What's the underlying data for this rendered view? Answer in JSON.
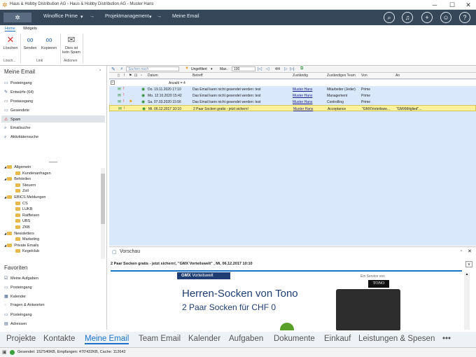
{
  "window": {
    "title": "Haus & Hobby Distribution AG - Haus & Hobby Distribution AG - Muster Hans",
    "min": "─",
    "max": "☐",
    "close": "✕"
  },
  "nav": {
    "app": "Winoffice Prime",
    "module": "Projektmanagement",
    "page": "Meine Email"
  },
  "ribbon": {
    "tabs": [
      "Home",
      "Widgets"
    ],
    "buttons": [
      {
        "label": "Löschen",
        "icon": "✕"
      },
      {
        "label": "Senden",
        "icon": "∞"
      },
      {
        "label": "Kopieren",
        "icon": "∞"
      },
      {
        "label": "Dies ist kein Spam",
        "icon": "✉"
      }
    ],
    "groups": [
      "Lösch...",
      "Link",
      "Aktionen"
    ]
  },
  "left": {
    "title": "Meine Email",
    "mail": [
      "Posteingang",
      "Entwürfe (64)",
      "Postausgang",
      "Gesendete",
      "Spam",
      "Emailsuche",
      "Aktivitätensuche"
    ],
    "tree": [
      {
        "label": "Allgemein",
        "level": 0
      },
      {
        "label": "Kundenanfragen",
        "level": 1
      },
      {
        "label": "Behörden",
        "level": 0
      },
      {
        "label": "Steuern",
        "level": 1
      },
      {
        "label": "Zoll",
        "level": 1
      },
      {
        "label": "EBICS Meldungen",
        "level": 0
      },
      {
        "label": "CS",
        "level": 1
      },
      {
        "label": "LUKB",
        "level": 1
      },
      {
        "label": "Raiffeisen",
        "level": 1
      },
      {
        "label": "UBS",
        "level": 1
      },
      {
        "label": "ZKB",
        "level": 1
      },
      {
        "label": "Newsletters",
        "level": 0
      },
      {
        "label": "Marketing",
        "level": 1
      },
      {
        "label": "Private Emails",
        "level": 0
      },
      {
        "label": "Kegelclub",
        "level": 1
      }
    ],
    "favorites_title": "Favoriten",
    "favorites": [
      "Meine Aufgaben",
      "Posteingang",
      "Kalender",
      "Fragen & Antworten",
      "Posteingang",
      "Adressen"
    ]
  },
  "toolbar": {
    "search_placeholder": "Suchen nach",
    "filter": "Ungefiltert",
    "max_label": "Max.",
    "max_value": "100",
    "page": "4/4"
  },
  "grid": {
    "columns": [
      "Datum",
      "Betreff",
      "Zuständig",
      "Zuständiges Team",
      "Von",
      "An"
    ],
    "count": "Anzahl = 4",
    "rows": [
      {
        "date": "Do. 19.11.2020 17:10",
        "subject": "Das Email kann nicht gesendet werden: test",
        "owner": "Muster Hans",
        "team": "Mitarbeiter (Jeder)",
        "from": "Prime",
        "to": ""
      },
      {
        "date": "Mo. 12.10.2020 15:42",
        "subject": "Das Email kann nicht gesendet werden: test",
        "owner": "Muster Hans",
        "team": "Management",
        "from": "Prime",
        "to": ""
      },
      {
        "date": "Sa. 07.03.2020 15:56",
        "subject": "Das Email kann nicht gesendet werden: test",
        "owner": "Muster Hans",
        "team": "Controlling",
        "from": "Prime",
        "to": ""
      },
      {
        "date": "Mi. 06.12.2017 10:10",
        "subject": "2 Paar Socken gratis - jetzt sichern!",
        "owner": "Muster Hans",
        "team": "Acceptance",
        "from": "\"GMXVorteilswe...",
        "to": "\"GMXMitglied\"..."
      }
    ]
  },
  "preview": {
    "title": "Vorschau",
    "header": "2 Paar Socken gratis - jetzt sichern!, \"GMX Vorteilswelt\" , Mi, 06.12.2017 10:10",
    "brand": "GMX",
    "brand_sub": "Vorteilswelt",
    "service": "Ein Service von",
    "logo": "TONO",
    "headline": "Herren-Socken von Tono",
    "subline": "2 Paar Socken für CHF 0"
  },
  "bottom_nav": [
    "Projekte",
    "Kontakte",
    "Meine Email",
    "Team Email",
    "Kalender",
    "Aufgaben",
    "Dokumente",
    "Einkauf",
    "Leistungen & Spesen",
    "•••"
  ],
  "status": {
    "text": "Gesendet: 152'540KB, Empfangen: 470'432KB, Cache: 112642"
  },
  "colors": {
    "nav_bg": "#36475a",
    "grid_bg": "#dae8fc",
    "selected_row": "#fbf29b",
    "accent": "#1a73c7"
  }
}
